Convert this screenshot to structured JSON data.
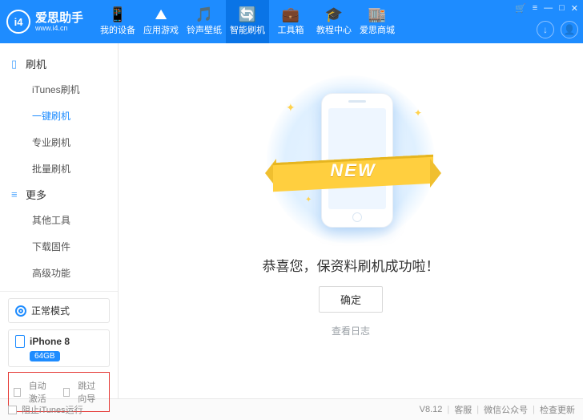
{
  "brand": {
    "name": "爱思助手",
    "url": "www.i4.cn",
    "logo_text": "i4"
  },
  "top_tabs": [
    {
      "icon": "📱",
      "label": "我的设备"
    },
    {
      "icon": "⛰",
      "label": "应用游戏"
    },
    {
      "icon": "🎵",
      "label": "铃声壁纸"
    },
    {
      "icon": "🔄",
      "label": "智能刷机"
    },
    {
      "icon": "💼",
      "label": "工具箱"
    },
    {
      "icon": "🎓",
      "label": "教程中心"
    },
    {
      "icon": "🏬",
      "label": "爱思商城"
    }
  ],
  "active_tab_index": 3,
  "win": {
    "cart": "🛒",
    "menu": "≡",
    "min": "—",
    "max": "□",
    "close": "✕"
  },
  "user": {
    "download": "↓",
    "profile": "👤"
  },
  "sidebar": {
    "group1": {
      "icon": "▯",
      "label": "刷机"
    },
    "items1": [
      "iTunes刷机",
      "一键刷机",
      "专业刷机",
      "批量刷机"
    ],
    "active1_index": 1,
    "group2": {
      "icon": "≡",
      "label": "更多"
    },
    "items2": [
      "其他工具",
      "下载固件",
      "高级功能"
    ],
    "mode": {
      "label": "正常模式"
    },
    "device": {
      "name": "iPhone 8",
      "storage": "64GB"
    },
    "checks": {
      "c1": "自动激活",
      "c2": "跳过向导"
    }
  },
  "main": {
    "ribbon": "NEW",
    "headline": "恭喜您，保资料刷机成功啦！",
    "ok": "确定",
    "view_log": "查看日志"
  },
  "footer": {
    "block_itunes": "阻止iTunes运行",
    "version": "V8.12",
    "support": "客服",
    "wechat": "微信公众号",
    "update": "检查更新"
  }
}
